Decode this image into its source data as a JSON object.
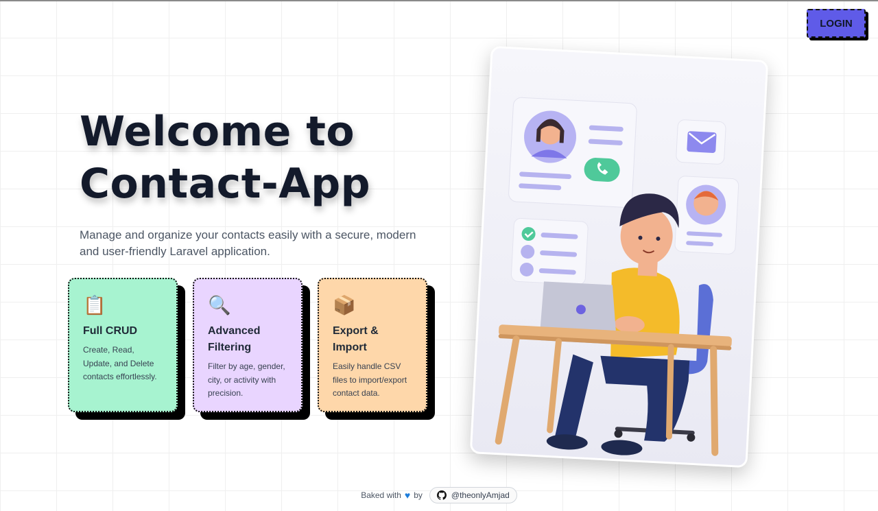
{
  "header": {
    "login_label": "LOGIN"
  },
  "hero": {
    "title_line1": "Welcome to",
    "title_line2": "Contact-App",
    "subtitle": "Manage and organize your contacts easily with a secure, modern and user-friendly Laravel application."
  },
  "features": [
    {
      "icon": "clipboard-icon",
      "emoji": "📋",
      "title": "Full CRUD",
      "desc": "Create, Read, Update, and Delete contacts effortlessly.",
      "color": "#a7f3d0"
    },
    {
      "icon": "magnifier-icon",
      "emoji": "🔍",
      "title": "Advanced Filtering",
      "desc": "Filter by age, gender, city, or activity with precision.",
      "color": "#e9d5ff"
    },
    {
      "icon": "package-icon",
      "emoji": "📦",
      "title": "Export & Import",
      "desc": "Easily handle CSV files to import/export contact data.",
      "color": "#fed7aa"
    }
  ],
  "footer": {
    "baked_with": "Baked with",
    "by": "by",
    "github_handle": "@theonlyAmjad",
    "heart_icon": "blue-heart-icon",
    "github_icon": "github-icon"
  },
  "colors": {
    "accent": "#5f5be8",
    "title": "#131a2b"
  }
}
